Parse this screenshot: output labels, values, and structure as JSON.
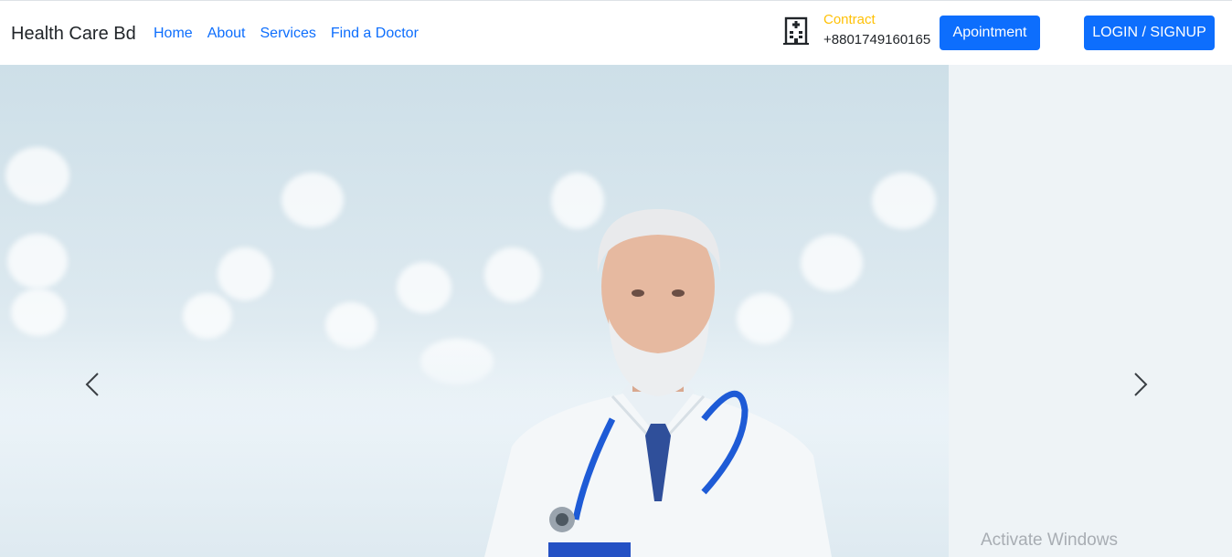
{
  "navbar": {
    "brand": "Health Care Bd",
    "links": [
      "Home",
      "About",
      "Services",
      "Find a Doctor"
    ],
    "contact": {
      "icon": "hospital-building-icon",
      "label": "Contract",
      "phone": "+8801749160165"
    },
    "appointment_button": "Apointment",
    "login_button": "LOGIN / SIGNUP"
  },
  "carousel": {
    "prev_icon": "chevron-left-icon",
    "next_icon": "chevron-right-icon",
    "slide_image": "doctor-with-stethoscope"
  },
  "os_overlay": {
    "watermark": "Activate Windows"
  },
  "colors": {
    "primary": "#0d6efd",
    "contact_label": "#ffc107",
    "brand_text": "#212529"
  }
}
